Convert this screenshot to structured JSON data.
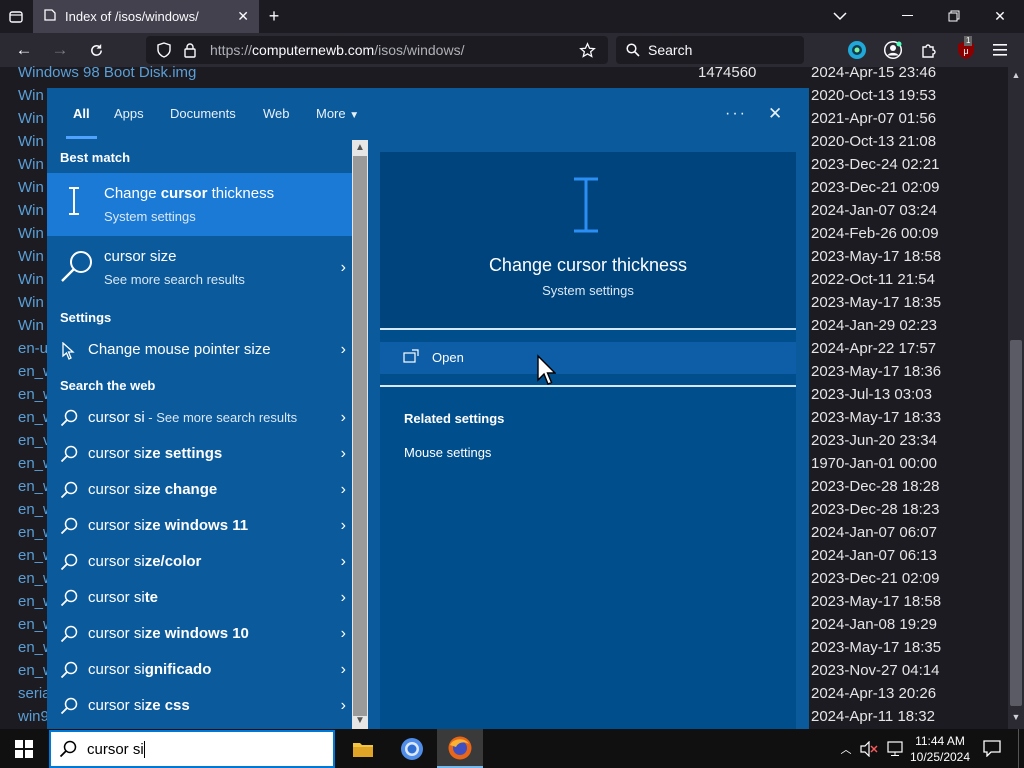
{
  "browser": {
    "tab_title": "Index of /isos/windows/",
    "url_prefix": "https://",
    "url_host": "computernewb.com",
    "url_path": "/isos/windows/",
    "search_placeholder": "Search",
    "ext_badge": "1"
  },
  "listing": [
    {
      "name": "Windows 98 Boot Disk.img",
      "size": "1474560",
      "date": "2024-Apr-15 23:46"
    },
    {
      "name": "Win",
      "size": "",
      "date": "2020-Oct-13 19:53"
    },
    {
      "name": "Win",
      "size": "",
      "date": "2021-Apr-07 01:56"
    },
    {
      "name": "Win",
      "size": "",
      "date": "2020-Oct-13 21:08"
    },
    {
      "name": "Win",
      "size": "",
      "date": "2023-Dec-24 02:21"
    },
    {
      "name": "Win",
      "size": "",
      "date": "2023-Dec-21 02:09"
    },
    {
      "name": "Win",
      "size": "",
      "date": "2024-Jan-07 03:24"
    },
    {
      "name": "Win",
      "size": "",
      "date": "2024-Feb-26 00:09"
    },
    {
      "name": "Win",
      "size": "",
      "date": "2023-May-17 18:58"
    },
    {
      "name": "Win",
      "size": "",
      "date": "2022-Oct-11 21:54"
    },
    {
      "name": "Win",
      "size": "",
      "date": "2023-May-17 18:35"
    },
    {
      "name": "Win",
      "size": "",
      "date": "2024-Jan-29 02:23"
    },
    {
      "name": "en-u",
      "size": "",
      "date": "2024-Apr-22 17:57"
    },
    {
      "name": "en_w",
      "size": "",
      "date": "2023-May-17 18:36"
    },
    {
      "name": "en_w",
      "size": "",
      "date": "2023-Jul-13 03:03"
    },
    {
      "name": "en_w",
      "size": "",
      "date": "2023-May-17 18:33"
    },
    {
      "name": "en_v",
      "size": "",
      "date": "2023-Jun-20 23:34"
    },
    {
      "name": "en_w",
      "size": "",
      "date": "1970-Jan-01 00:00"
    },
    {
      "name": "en_w",
      "size": "",
      "date": "2023-Dec-28 18:28"
    },
    {
      "name": "en_w",
      "size": "",
      "date": "2023-Dec-28 18:23"
    },
    {
      "name": "en_w",
      "size": "",
      "date": "2024-Jan-07 06:07"
    },
    {
      "name": "en_w",
      "size": "",
      "date": "2024-Jan-07 06:13"
    },
    {
      "name": "en_w",
      "size": "",
      "date": "2023-Dec-21 02:09"
    },
    {
      "name": "en_w",
      "size": "",
      "date": "2023-May-17 18:58"
    },
    {
      "name": "en_w",
      "size": "",
      "date": "2024-Jan-08 19:29"
    },
    {
      "name": "en_w",
      "size": "",
      "date": "2023-May-17 18:35"
    },
    {
      "name": "en_w",
      "size": "",
      "date": "2023-Nov-27 04:14"
    },
    {
      "name": "seria",
      "size": "",
      "date": "2024-Apr-13 20:26"
    },
    {
      "name": "win9",
      "size": "",
      "date": "2024-Apr-11 18:32"
    }
  ],
  "search_panel": {
    "tabs": [
      "All",
      "Apps",
      "Documents",
      "Web",
      "More"
    ],
    "sections": {
      "best_match": "Best match",
      "settings": "Settings",
      "search_web": "Search the web"
    },
    "best": {
      "title_pre": "Change ",
      "title_bold": "cursor",
      "title_post": " thickness",
      "subtitle": "System settings"
    },
    "more_results": {
      "title": "cursor size",
      "subtitle": "See more search results"
    },
    "setting_item": "Change mouse pointer size",
    "web_first": {
      "pre": "cursor si",
      "post": " - See more search results"
    },
    "web_items": [
      {
        "pre": "cursor si",
        "bold": "ze settings"
      },
      {
        "pre": "cursor si",
        "bold": "ze change"
      },
      {
        "pre": "cursor si",
        "bold": "ze windows 11"
      },
      {
        "pre": "cursor si",
        "bold": "ze/color"
      },
      {
        "pre": "cursor si",
        "bold": "te"
      },
      {
        "pre": "cursor si",
        "bold": "ze windows 10"
      },
      {
        "pre": "cursor si",
        "bold": "gnificado"
      },
      {
        "pre": "cursor si",
        "bold": "ze css"
      }
    ],
    "detail": {
      "title": "Change cursor thickness",
      "subtitle": "System settings",
      "open": "Open",
      "related_heading": "Related settings",
      "related_item": "Mouse settings"
    }
  },
  "taskbar": {
    "search_value": "cursor si",
    "time": "11:44 AM",
    "date": "10/25/2024"
  },
  "colors": {
    "panel": "#0a5a9c",
    "highlight": "#1a7ad6",
    "link": "#5a9fd6"
  }
}
